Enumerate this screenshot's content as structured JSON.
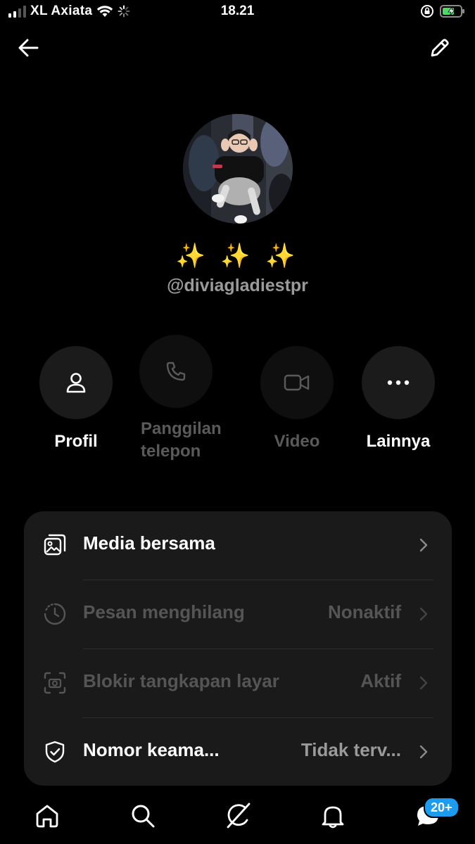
{
  "status_bar": {
    "carrier": "XL Axiata",
    "time": "18.21"
  },
  "profile": {
    "display_name": "✨ ✨ ✨",
    "username": "@diviagladiestpr"
  },
  "actions": [
    {
      "label": "Profil",
      "icon": "person-icon",
      "enabled": true
    },
    {
      "label": "Panggilan telepon",
      "icon": "phone-icon",
      "enabled": false
    },
    {
      "label": "Video",
      "icon": "video-icon",
      "enabled": false
    },
    {
      "label": "Lainnya",
      "icon": "more-icon",
      "enabled": true
    }
  ],
  "settings": [
    {
      "label": "Media bersama",
      "value": "",
      "icon": "media-icon",
      "enabled": true
    },
    {
      "label": "Pesan menghilang",
      "value": "Nonaktif",
      "icon": "timer-icon",
      "enabled": false
    },
    {
      "label": "Blokir tangkapan layar",
      "value": "Aktif",
      "icon": "screenshot-icon",
      "enabled": false
    },
    {
      "label": "Nomor keama...",
      "value": "Tidak terv...",
      "icon": "shield-icon",
      "enabled": true
    }
  ],
  "bottom_nav": {
    "items": [
      "home-icon",
      "search-icon",
      "grok-icon",
      "notifications-icon",
      "messages-icon"
    ],
    "badge": "20+"
  },
  "colors": {
    "background": "#000000",
    "card": "#1a1a1a",
    "accent": "#1d9bf0",
    "disabled_text": "#555555"
  }
}
